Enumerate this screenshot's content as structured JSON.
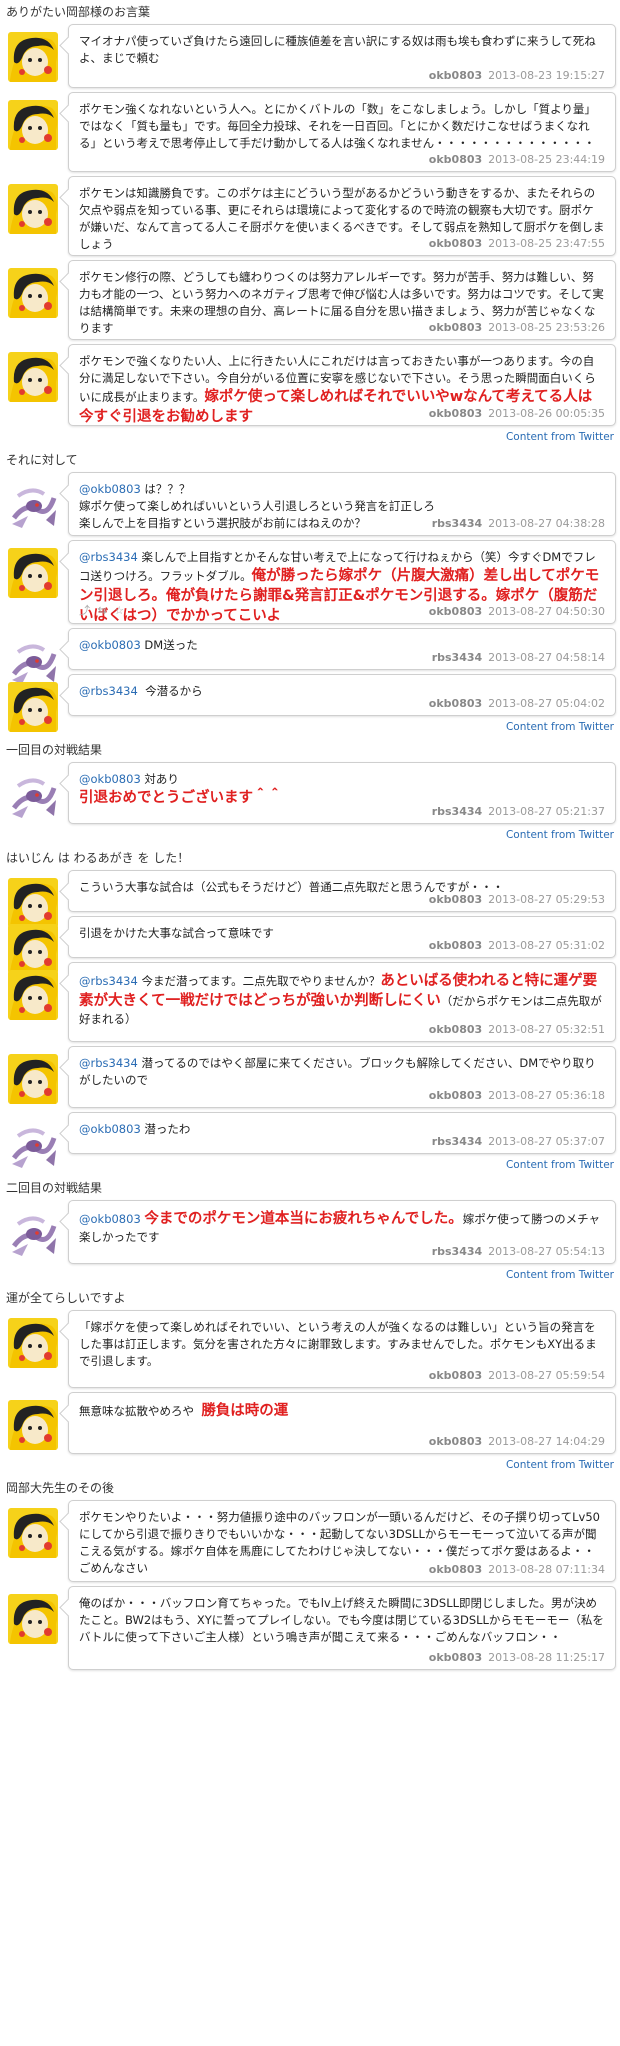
{
  "sections": [
    {
      "heading": "ありがたい岡部様のお言葉",
      "tweets": [
        {
          "avatar": "yellow",
          "h": 64,
          "parts": [
            {
              "t": "マイオナパ使っていざ負けたら遠回しに種族値差を言い訳にする奴は雨も埃も食わずに来うして死ねよ、まじで頼む"
            }
          ],
          "user": "okb0803",
          "time": "2013-08-23 19:15:27"
        },
        {
          "avatar": "yellow",
          "h": 80,
          "parts": [
            {
              "t": "ポケモン強くなれないという人へ。とにかくバトルの「数」をこなしましょう。しかし「質より量」ではなく「質も量も」です。毎回全力投球、それを一日百回。「とにかく数だけこなせばうまくなれる」という考えで思考停止して手だけ動かしてる人は強くなれません・・・・・・・・・・・・・・"
            }
          ],
          "user": "okb0803",
          "time": "2013-08-25 23:44:19"
        },
        {
          "avatar": "yellow",
          "h": 80,
          "parts": [
            {
              "t": "ポケモンは知識勝負です。このポケは主にどういう型があるかどういう動きをするか、またそれらの欠点や弱点を知っている事、更にそれらは環境によって変化するので時流の観察も大切です。厨ポケが嫌いだ、なんて言ってる人こそ厨ポケを使いまくるべきです。そして弱点を熟知して厨ポケを倒しましょう"
            }
          ],
          "user": "okb0803",
          "time": "2013-08-25 23:47:55"
        },
        {
          "avatar": "yellow",
          "h": 80,
          "parts": [
            {
              "t": "ポケモン修行の際、どうしても纏わりつくのは努力アレルギーです。努力が苦手、努力は難しい、努力も才能の一つ、という努力へのネガティブ思考で伸び悩む人は多いです。努力はコツです。そして実は結構簡単です。未来の理想の自分、高レートに届る自分を思い描きましょう、努力が苦じゃなくなります"
            }
          ],
          "user": "okb0803",
          "time": "2013-08-25 23:53:26"
        },
        {
          "avatar": "yellow",
          "h": 82,
          "parts": [
            {
              "t": "ポケモンで強くなりたい人、上に行きたい人にこれだけは言っておきたい事が一つあります。今の自分に満足しないで下さい。今自分がいる位置に安寧を感じないで下さい。そう思った瞬間面白いくらいに成長が止まります。"
            },
            {
              "t": "嫁ポケ使って楽しめればそれでいいやwなんて考えてる人は今すぐ引退をお勧めします",
              "c": "red"
            }
          ],
          "user": "okb0803",
          "time": "2013-08-26 00:05:35"
        }
      ],
      "footer": "Content from Twitter"
    },
    {
      "heading": "それに対して",
      "tweets": [
        {
          "avatar": "purple",
          "h": 64,
          "parts": [
            {
              "t": "@okb0803",
              "c": "mention"
            },
            {
              "t": " は？？？\n嫁ポケ使って楽しめればいいという人引退しろという発言を訂正しろ\n楽しんで上を目指すという選択肢がお前にはねえのか？"
            }
          ],
          "user": "rbs3434",
          "time": "2013-08-27 04:38:28"
        },
        {
          "avatar": "yellow",
          "h": 84,
          "parts": [
            {
              "t": "@rbs3434",
              "c": "mention"
            },
            {
              "t": " 楽しんで上目指すとかそんな甘い考えで上になって行けねぇから（笑）今すぐDMでフレコ送りつけろ。フラットダブル。"
            },
            {
              "t": "俺が勝ったら嫁ポケ（片腹大激痛）差し出してポケモン引退しろ。俺が負けたら謝罪&発言訂正&ポケモン引退する。嫁ポケ（腹筋だいばくはつ）でかかってこいよ",
              "c": "red"
            }
          ],
          "user": "okb0803",
          "time": "2013-08-27 04:50:30",
          "actions": "⤴ ⇆ ☆"
        },
        {
          "avatar": "purple",
          "h": 42,
          "parts": [
            {
              "t": "@okb0803",
              "c": "mention"
            },
            {
              "t": " DM送った"
            }
          ],
          "user": "rbs3434",
          "time": "2013-08-27 04:58:14"
        },
        {
          "avatar": "yellow",
          "h": 42,
          "parts": [
            {
              "t": "@rbs3434",
              "c": "mention"
            },
            {
              "t": "  今潜るから"
            }
          ],
          "user": "okb0803",
          "time": "2013-08-27 05:04:02"
        }
      ],
      "footer": "Content from Twitter"
    },
    {
      "heading": "一回目の対戦結果",
      "tweets": [
        {
          "avatar": "purple",
          "h": 62,
          "parts": [
            {
              "t": "@okb0803",
              "c": "mention"
            },
            {
              "t": " 対あり\n"
            },
            {
              "t": "引退おめでとうございます＾＾",
              "c": "red"
            }
          ],
          "user": "rbs3434",
          "time": "2013-08-27 05:21:37"
        }
      ],
      "footer": "Content from Twitter"
    },
    {
      "heading": "はいじん は わるあがき を した！",
      "tweets": [
        {
          "avatar": "yellow",
          "h": 42,
          "parts": [
            {
              "t": "こういう大事な試合は（公式もそうだけど）普通二点先取だと思うんですが・・・"
            }
          ],
          "user": "okb0803",
          "time": "2013-08-27 05:29:53"
        },
        {
          "avatar": "yellow",
          "h": 42,
          "parts": [
            {
              "t": "引退をかけた大事な試合って意味です"
            }
          ],
          "user": "okb0803",
          "time": "2013-08-27 05:31:02"
        },
        {
          "avatar": "yellow",
          "h": 80,
          "parts": [
            {
              "t": "@rbs3434",
              "c": "mention"
            },
            {
              "t": " 今まだ潜ってます。二点先取でやりませんか？"
            },
            {
              "t": "あといばる使われると特に運ゲ要素が大きくて一戦だけではどっちが強いか判断しにくい",
              "c": "red"
            },
            {
              "t": "（だからポケモンは二点先取が好まれる）"
            }
          ],
          "user": "okb0803",
          "time": "2013-08-27 05:32:51"
        },
        {
          "avatar": "yellow",
          "h": 62,
          "parts": [
            {
              "t": "@rbs3434",
              "c": "mention"
            },
            {
              "t": " 潜ってるのではやく部屋に来てください。ブロックも解除してください、DMでやり取りがしたいので"
            }
          ],
          "user": "okb0803",
          "time": "2013-08-27 05:36:18"
        },
        {
          "avatar": "purple",
          "h": 42,
          "parts": [
            {
              "t": "@okb0803",
              "c": "mention"
            },
            {
              "t": " 潜ったわ"
            }
          ],
          "user": "rbs3434",
          "time": "2013-08-27 05:37:07"
        }
      ],
      "footer": "Content from Twitter"
    },
    {
      "heading": "二回目の対戦結果",
      "tweets": [
        {
          "avatar": "purple",
          "h": 64,
          "parts": [
            {
              "t": "@okb0803",
              "c": "mention"
            },
            {
              "t": " "
            },
            {
              "t": "今までのポケモン道本当にお疲れちゃんでした。",
              "c": "red"
            },
            {
              "t": "嫁ポケ使って勝つのメチャ楽しかったです"
            }
          ],
          "user": "rbs3434",
          "time": "2013-08-27 05:54:13"
        }
      ],
      "footer": "Content from Twitter"
    },
    {
      "heading": "運が全てらしいですよ",
      "tweets": [
        {
          "avatar": "yellow",
          "h": 78,
          "parts": [
            {
              "t": "「嫁ポケを使って楽しめればそれでいい、という考えの人が強くなるのは難しい」という旨の発言をした事は訂正します。気分を害された方々に謝罪致します。すみませんでした。ポケモンもXY出るまで引退します。"
            }
          ],
          "user": "okb0803",
          "time": "2013-08-27 05:59:54"
        },
        {
          "avatar": "yellow",
          "h": 62,
          "parts": [
            {
              "t": "無意味な拡散やめろや  "
            },
            {
              "t": "勝負は時の運",
              "c": "red"
            }
          ],
          "user": "okb0803",
          "time": "2013-08-27 14:04:29"
        }
      ],
      "footer": "Content from Twitter"
    },
    {
      "heading": "岡部大先生のその後",
      "tweets": [
        {
          "avatar": "yellow",
          "h": 82,
          "parts": [
            {
              "t": "ポケモンやりたいよ・・・努力値振り途中のバッフロンが一頭いるんだけど、その子撰り切ってLv50にしてから引退で振りきりでもいいかな・・・起動してない3DSLLからモーモーって泣いてる声が聞こえる気がする。嫁ポケ自体を馬鹿にしてたわけじゃ決してない・・・僕だってポケ愛はあるよ・・ごめんなさい"
            }
          ],
          "user": "okb0803",
          "time": "2013-08-28 07:11:34"
        },
        {
          "avatar": "yellow",
          "h": 84,
          "parts": [
            {
              "t": "俺のばか・・・バッフロン育てちゃった。でもlv上げ終えた瞬間に3DSLL即閉じしました。男が決めたこと。BW2はもう、XYに誓ってプレイしない。でも今度は閉じている3DSLLからモモーモー（私をバトルに使って下さいご主人様）という鳴き声が聞こえて来る・・・ごめんなバッフロン・・"
            }
          ],
          "user": "okb0803",
          "time": "2013-08-28 11:25:17"
        }
      ]
    }
  ]
}
